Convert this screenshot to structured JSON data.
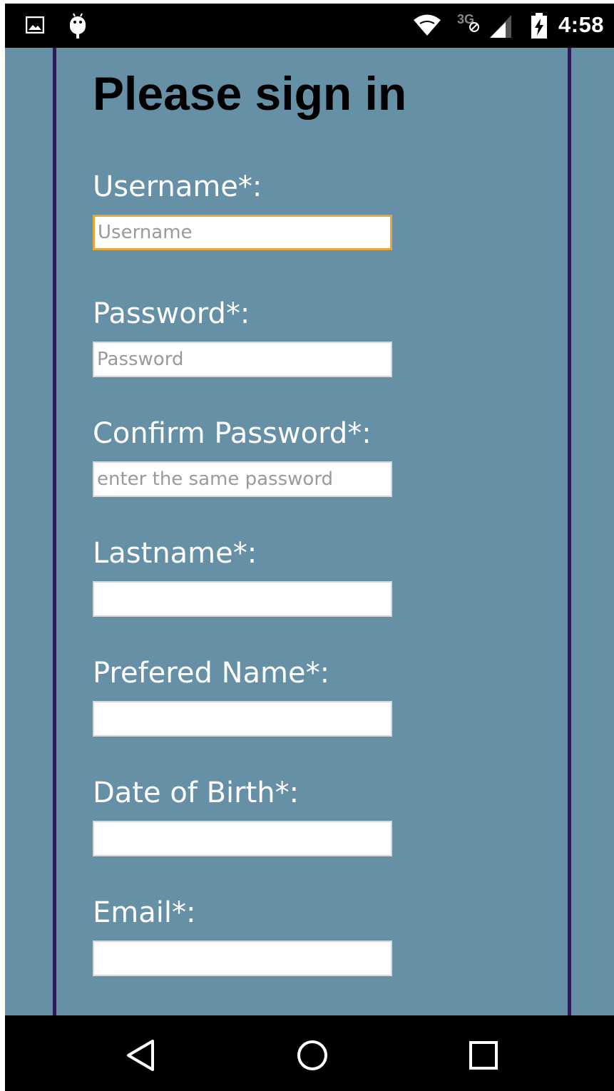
{
  "status_bar": {
    "time": "4:58",
    "network_type": "3G",
    "icons": [
      "gallery-icon",
      "android-debug-icon",
      "wifi-icon",
      "network-3g-icon",
      "cell-signal-icon",
      "battery-charging-icon"
    ]
  },
  "page": {
    "title": "Please sign in",
    "background_color": "#6590a5",
    "rail_color": "#2b1c57",
    "focus_color": "#e3a73a"
  },
  "form": {
    "fields": [
      {
        "label": "Username*:",
        "placeholder": "Username",
        "value": "",
        "focused": true
      },
      {
        "label": "Password*:",
        "placeholder": "Password",
        "value": ""
      },
      {
        "label": "Confirm Password*:",
        "placeholder": "enter the same password",
        "value": ""
      },
      {
        "label": "Lastname*:",
        "placeholder": "",
        "value": ""
      },
      {
        "label": "Prefered Name*:",
        "placeholder": "",
        "value": ""
      },
      {
        "label": "Date of Birth*:",
        "placeholder": "",
        "value": ""
      },
      {
        "label": "Email*:",
        "placeholder": "",
        "value": ""
      }
    ]
  },
  "nav_bar": {
    "buttons": [
      "back-icon",
      "home-icon",
      "recents-icon"
    ]
  }
}
